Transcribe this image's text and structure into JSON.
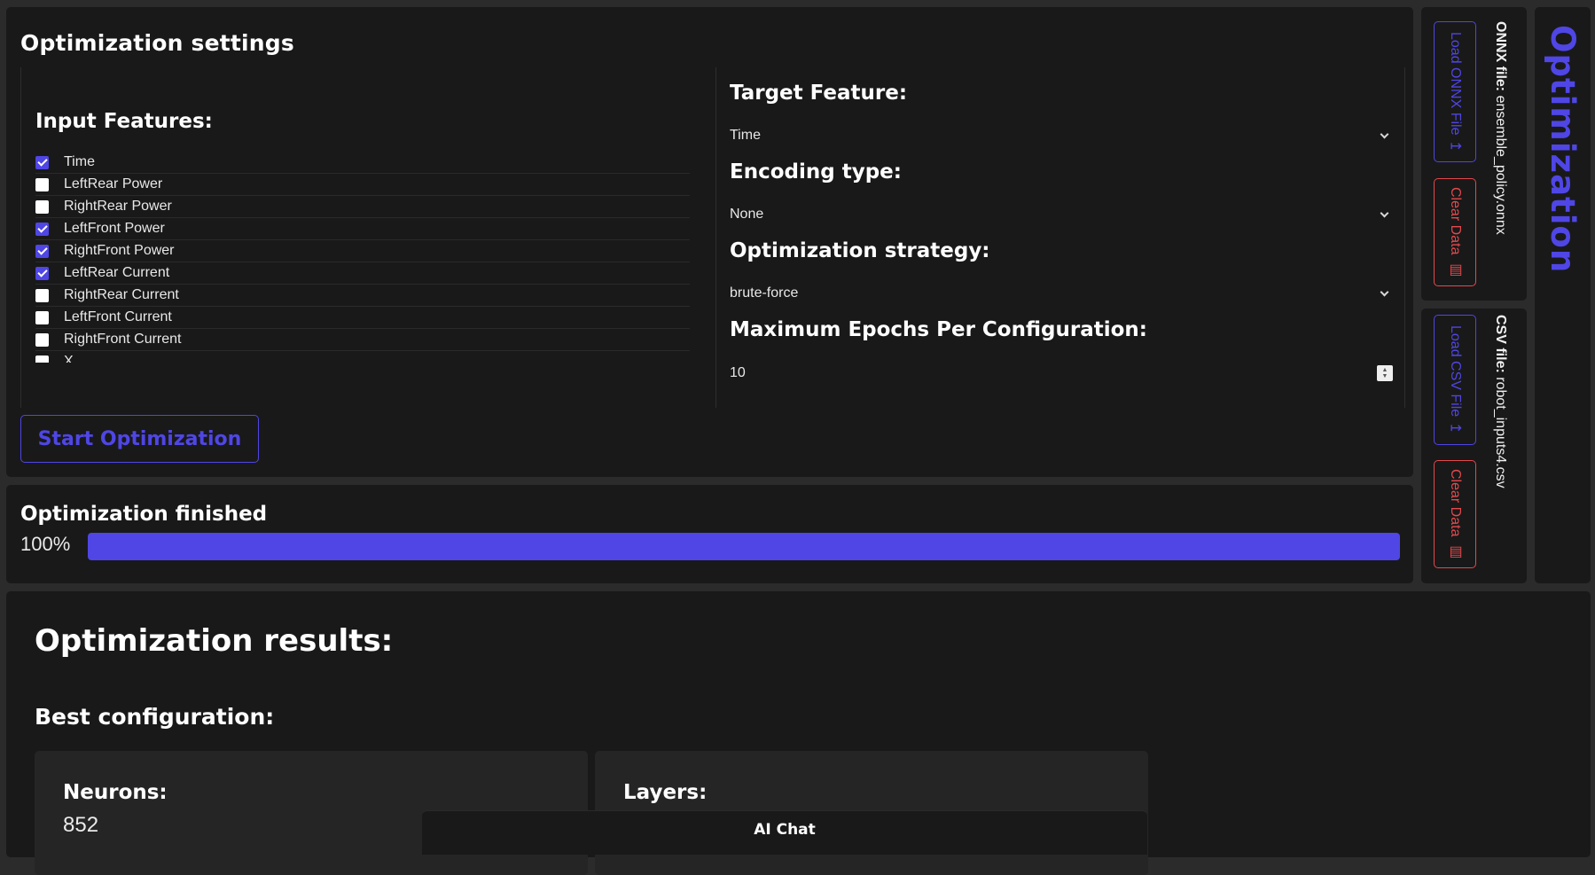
{
  "settings": {
    "title": "Optimization settings",
    "input_features_heading": "Input Features:",
    "features": [
      {
        "label": "Time",
        "checked": true
      },
      {
        "label": "LeftRear Power",
        "checked": false
      },
      {
        "label": "RightRear Power",
        "checked": false
      },
      {
        "label": "LeftFront Power",
        "checked": true
      },
      {
        "label": "RightFront Power",
        "checked": true
      },
      {
        "label": "LeftRear Current",
        "checked": true
      },
      {
        "label": "RightRear Current",
        "checked": false
      },
      {
        "label": "LeftFront Current",
        "checked": false
      },
      {
        "label": "RightFront Current",
        "checked": false
      },
      {
        "label": "X",
        "checked": false
      }
    ],
    "target_feature_heading": "Target Feature:",
    "target_feature_value": "Time",
    "encoding_heading": "Encoding type:",
    "encoding_value": "None",
    "strategy_heading": "Optimization strategy:",
    "strategy_value": "brute-force",
    "epochs_heading": "Maximum Epochs Per Configuration:",
    "epochs_value": "10",
    "start_button": "Start Optimization"
  },
  "progress": {
    "title": "Optimization finished",
    "percent_label": "100%",
    "fraction": 1.0
  },
  "onnx": {
    "load_button": "Load ONNX File",
    "clear_button": "Clear Data",
    "file_label": "ONNX file:",
    "file_name": "ensemble_policy.onnx"
  },
  "csv": {
    "load_button": "Load CSV File",
    "clear_button": "Clear Data",
    "file_label": "CSV file:",
    "file_name": "robot_inputs4.csv"
  },
  "brand": "Optimization",
  "results": {
    "title": "Optimization results:",
    "best_heading": "Best configuration:",
    "neurons_label": "Neurons:",
    "neurons_value": "852",
    "layers_label": "Layers:"
  },
  "ai_chat": "AI Chat",
  "colors": {
    "accent": "#4f46e5",
    "danger": "#e5484d",
    "panel": "#191919",
    "background": "#2b2b2b"
  }
}
